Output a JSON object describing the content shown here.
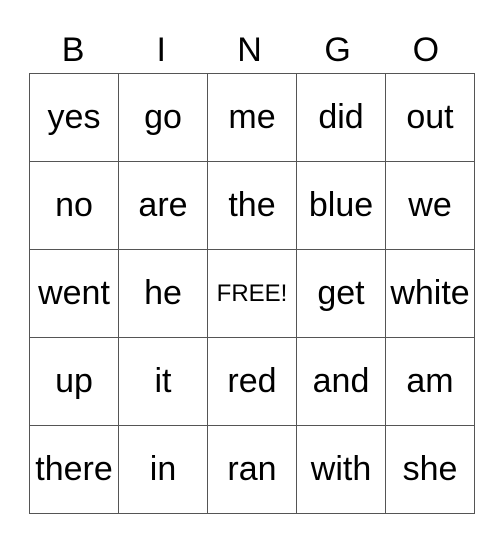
{
  "header": [
    "B",
    "I",
    "N",
    "G",
    "O"
  ],
  "rows": [
    [
      "yes",
      "go",
      "me",
      "did",
      "out"
    ],
    [
      "no",
      "are",
      "the",
      "blue",
      "we"
    ],
    [
      "went",
      "he",
      "FREE!",
      "get",
      "white"
    ],
    [
      "up",
      "it",
      "red",
      "and",
      "am"
    ],
    [
      "there",
      "in",
      "ran",
      "with",
      "she"
    ]
  ]
}
